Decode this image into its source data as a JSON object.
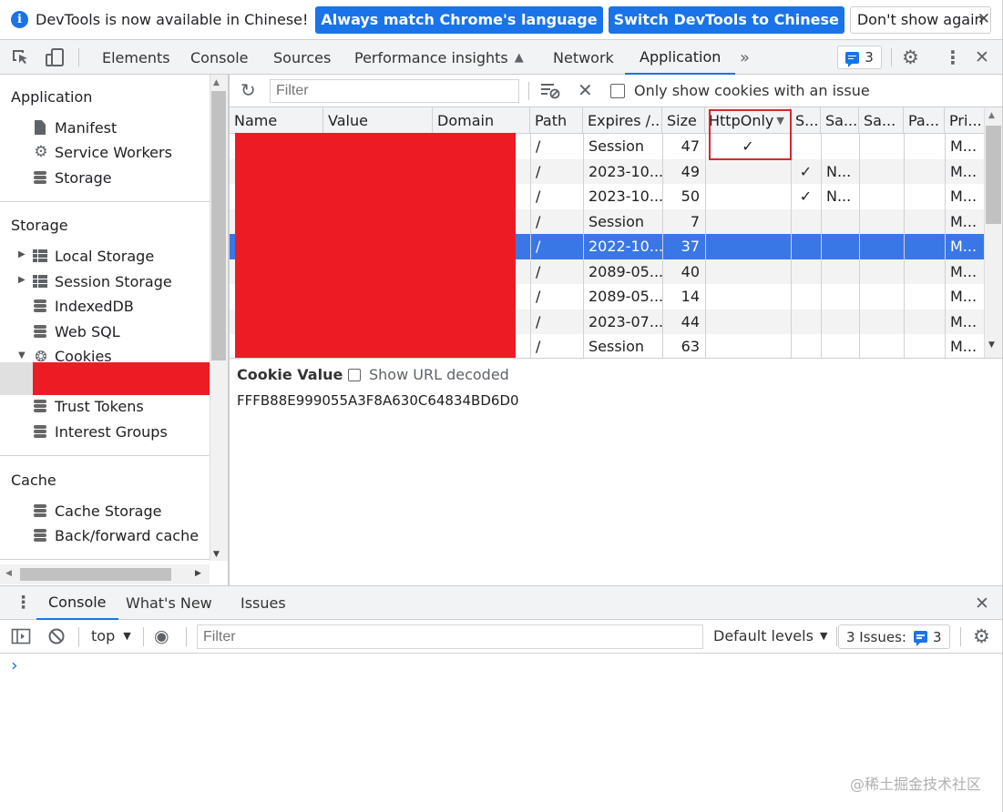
{
  "infobar": {
    "message": "DevTools is now available in Chinese!",
    "btn_match": "Always match Chrome's language",
    "btn_switch": "Switch DevTools to Chinese",
    "btn_dont_show": "Don't show again",
    "close": "✕"
  },
  "tabs": [
    "Elements",
    "Console",
    "Sources",
    "Performance insights",
    "Network",
    "Application"
  ],
  "tabs_more": "»",
  "issues_count": "3",
  "sidebar": {
    "application_heading": "Application",
    "application_items": [
      "Manifest",
      "Service Workers",
      "Storage"
    ],
    "storage_heading": "Storage",
    "storage_items": [
      "Local Storage",
      "Session Storage",
      "IndexedDB",
      "Web SQL",
      "Cookies"
    ],
    "storage_items_after": [
      "Trust Tokens",
      "Interest Groups"
    ],
    "cache_heading": "Cache",
    "cache_items": [
      "Cache Storage",
      "Back/forward cache"
    ]
  },
  "cookies_toolbar": {
    "filter_placeholder": "Filter",
    "only_issue_label": "Only show cookies with an issue"
  },
  "table": {
    "headers": [
      "Name",
      "Value",
      "Domain",
      "Path",
      "Expires /...",
      "Size",
      "HttpOnly",
      "S...",
      "Sa...",
      "Sa...",
      "Pa...",
      "Pri..."
    ],
    "rows": [
      {
        "path": "/",
        "expires": "Session",
        "size": "47",
        "httponly": "✓",
        "secure": "",
        "samesite": "",
        "priority": "M..."
      },
      {
        "path": "/",
        "expires": "2023-10...",
        "size": "49",
        "httponly": "",
        "secure": "✓",
        "samesite": "N...",
        "priority": "M..."
      },
      {
        "path": "/",
        "expires": "2023-10...",
        "size": "50",
        "httponly": "",
        "secure": "✓",
        "samesite": "N...",
        "priority": "M..."
      },
      {
        "path": "/",
        "expires": "Session",
        "size": "7",
        "httponly": "",
        "secure": "",
        "samesite": "",
        "priority": "M..."
      },
      {
        "path": "/",
        "expires": "2022-10...",
        "size": "37",
        "httponly": "",
        "secure": "",
        "samesite": "",
        "priority": "M..."
      },
      {
        "path": "/",
        "expires": "2089-05...",
        "size": "40",
        "httponly": "",
        "secure": "",
        "samesite": "",
        "priority": "M..."
      },
      {
        "path": "/",
        "expires": "2089-05...",
        "size": "14",
        "httponly": "",
        "secure": "",
        "samesite": "",
        "priority": "M..."
      },
      {
        "path": "/",
        "expires": "2023-07...",
        "size": "44",
        "httponly": "",
        "secure": "",
        "samesite": "",
        "priority": "M..."
      },
      {
        "path": "/",
        "expires": "Session",
        "size": "63",
        "httponly": "",
        "secure": "",
        "samesite": "",
        "priority": "M..."
      }
    ],
    "selected_row": 4
  },
  "cookie_value": {
    "title": "Cookie Value",
    "show_decoded_label": "Show URL decoded",
    "value": "FFFB88E999055A3F8A630C64834BD6D0"
  },
  "drawer": {
    "tabs": [
      "Console",
      "What's New",
      "Issues"
    ],
    "context": "top",
    "filter_placeholder": "Filter",
    "default_levels": "Default levels",
    "issues_label": "3 Issues:",
    "issues_count": "3",
    "prompt": "›"
  },
  "watermark": "@稀土掘金技术社区",
  "colors": {
    "accent": "#1a73e8",
    "selected_row": "#3a77e6",
    "redaction": "#ed1c24",
    "highlight_box": "#d9262c"
  }
}
